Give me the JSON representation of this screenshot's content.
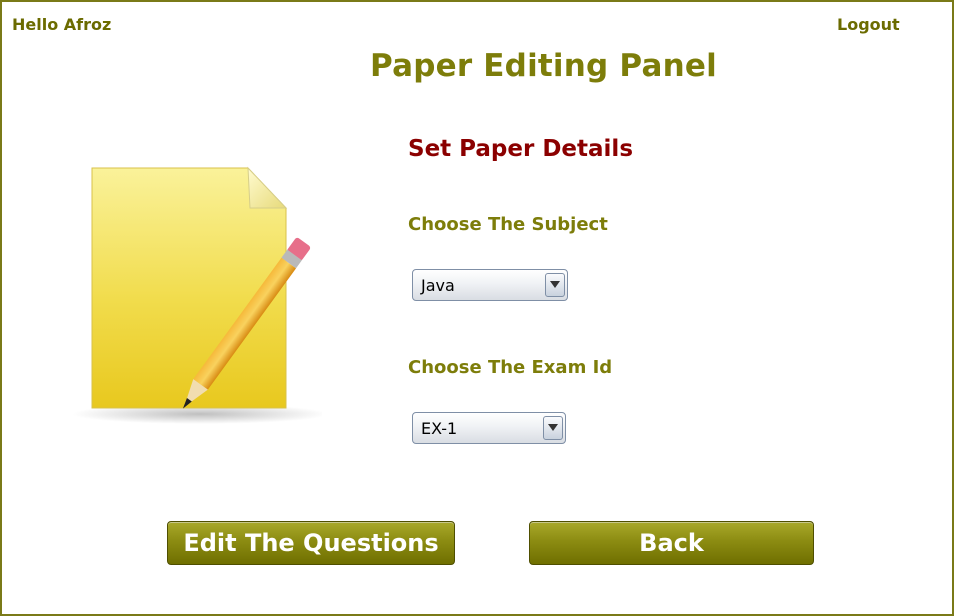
{
  "header": {
    "greeting": "Hello Afroz",
    "logout_label": "Logout"
  },
  "panel": {
    "title": "Paper Editing Panel",
    "subtitle": "Set Paper Details"
  },
  "form": {
    "subject_label": "Choose The Subject",
    "subject_value": "Java",
    "exam_label": "Choose The Exam Id",
    "exam_value": "EX-1"
  },
  "actions": {
    "edit_label": "Edit The Questions",
    "back_label": "Back"
  },
  "icons": {
    "document_edit": "document-pencil-icon",
    "dropdown_arrow": "chevron-down-icon"
  },
  "colors": {
    "accent": "#7d7d0a",
    "subtitle": "#8b0000",
    "button": "#8c8c12"
  }
}
